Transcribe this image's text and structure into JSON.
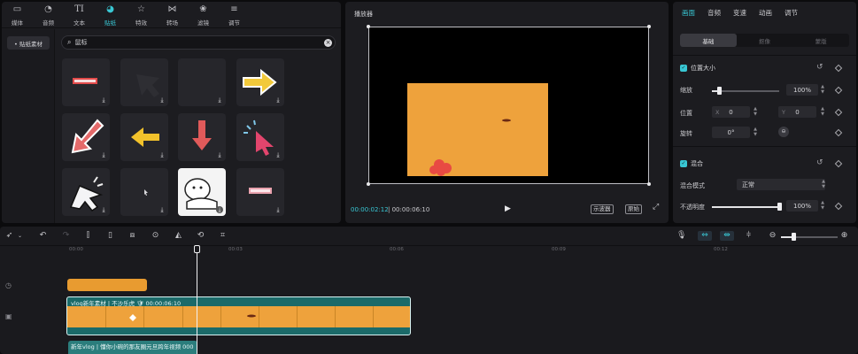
{
  "media_tabs": [
    {
      "label": "媒体",
      "icon": "media-icon"
    },
    {
      "label": "音频",
      "icon": "audio-icon"
    },
    {
      "label": "文本",
      "icon": "text-icon"
    },
    {
      "label": "贴纸",
      "icon": "sticker-icon",
      "active": true
    },
    {
      "label": "特效",
      "icon": "effects-icon"
    },
    {
      "label": "转场",
      "icon": "transition-icon"
    },
    {
      "label": "滤镜",
      "icon": "filter-icon"
    },
    {
      "label": "调节",
      "icon": "adjust-icon"
    }
  ],
  "sidebar": {
    "chip": "• 贴纸素材"
  },
  "search": {
    "value": "鼠标"
  },
  "player": {
    "title": "播放器",
    "time_current": "00:00:02:12",
    "time_total": "00:00:06:10",
    "btn_scope": "示波器",
    "btn_ratio": "原始"
  },
  "props": {
    "tabs": [
      "画面",
      "音频",
      "变速",
      "动画",
      "调节"
    ],
    "subtabs": [
      "基础",
      "抠像",
      "蒙版"
    ],
    "position_size": "位置大小",
    "scale_label": "缩放",
    "scale_value": "100%",
    "scale_level": 0.1,
    "position_label": "位置",
    "x_prefix": "X",
    "x_value": "0",
    "y_prefix": "Y",
    "y_value": "0",
    "rotate_label": "旋转",
    "rotate_value": "0°",
    "blend_title": "混合",
    "blend_mode_label": "混合模式",
    "blend_mode_value": "正常",
    "opacity_label": "不透明度",
    "opacity_value": "100%",
    "opacity_level": 1.0
  },
  "timeline": {
    "ticks": [
      "00:00",
      "00:03",
      "00:06",
      "00:09",
      "00:12"
    ],
    "video_clip_title": "vlog新年素材 | 不沙乐虎 🛡 00:00:06:10",
    "audio_clip_title": "新年vlog | 懂你小碗的那友圈元旦跨年视频  000"
  },
  "colors": {
    "accent": "#39c7d4",
    "clip_teal": "#1b6a69",
    "orange": "#eea23c"
  }
}
